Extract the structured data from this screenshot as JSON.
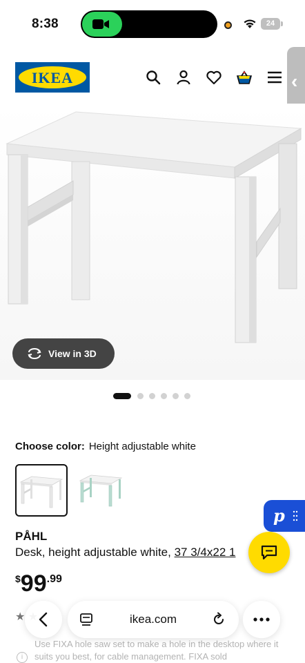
{
  "status_bar": {
    "time": "8:38",
    "battery": "24"
  },
  "header": {
    "logo_text": "IKEA",
    "icons": [
      "search-icon",
      "account-icon",
      "heart-icon",
      "shopping-bag-icon",
      "hamburger-menu-icon"
    ],
    "side_tab_glyph": "‹"
  },
  "product": {
    "view_3d_label": "View in 3D",
    "image_count": 6,
    "active_image_index": 0,
    "choose_color_label": "Choose color:",
    "selected_color": "Height adjustable white",
    "color_options": [
      "Height adjustable white",
      "white/green"
    ],
    "name": "PÅHL",
    "description": "Desk, height adjustable white, ",
    "dimensions": "37 3/4x22 1",
    "price_currency": "$",
    "price_whole": "99",
    "price_cents": ".99"
  },
  "below_fold": {
    "rating_text": "★ ★",
    "description_text": "Use FIXA hole saw set to make a hole in the desktop where it suits you best, for cable management. FIXA sold"
  },
  "browser": {
    "domain": "ikea.com"
  },
  "colors": {
    "ikea_blue": "#0058a3",
    "ikea_yellow": "#ffdb00",
    "chat_fab": "#ffdb00",
    "p_badge": "#1a4fd6"
  }
}
